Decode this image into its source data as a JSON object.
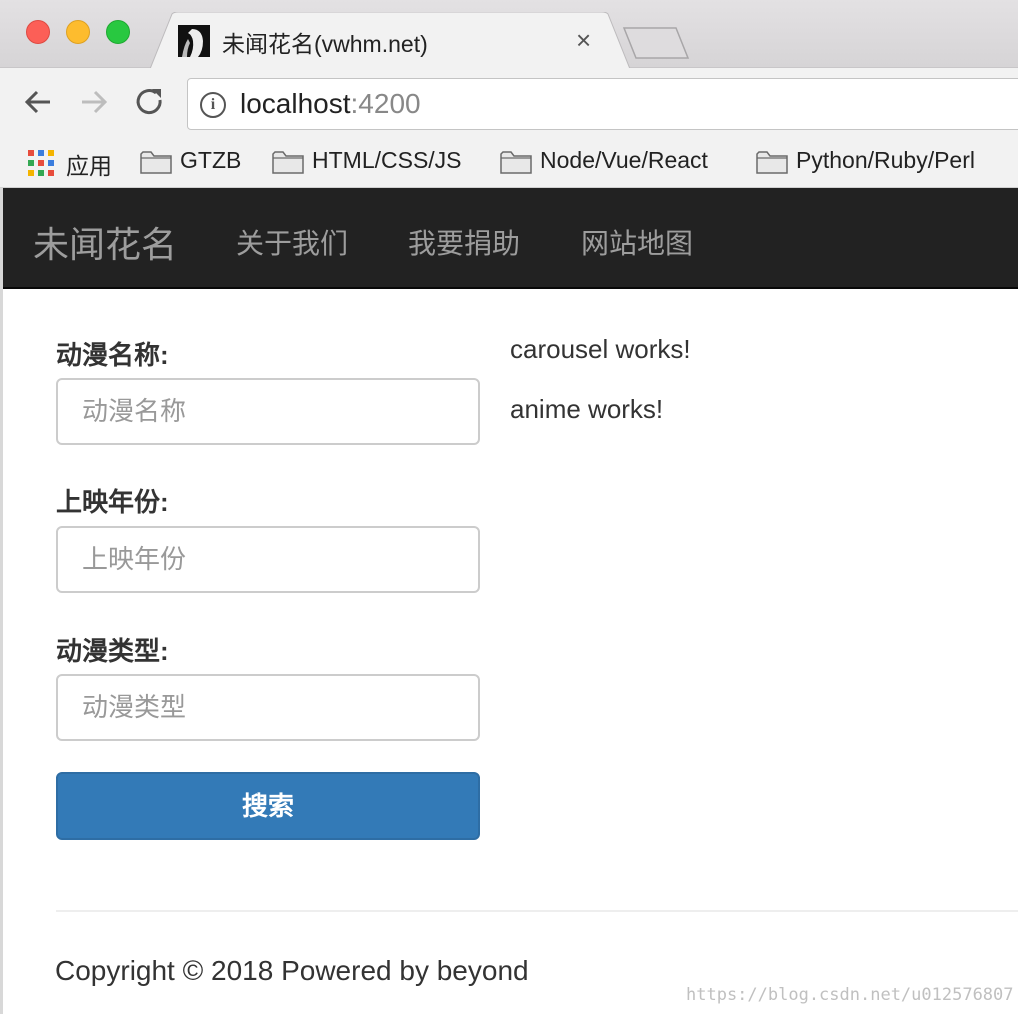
{
  "browser": {
    "tab": {
      "title": "未闻花名(vwhm.net)",
      "close_glyph": "×"
    },
    "address": {
      "host": "localhost",
      "port": ":4200"
    },
    "bookmarks": [
      {
        "label": "应用",
        "icon": "apps-grid-icon"
      },
      {
        "label": "GTZB",
        "icon": "folder-icon"
      },
      {
        "label": "HTML/CSS/JS",
        "icon": "folder-icon"
      },
      {
        "label": "Node/Vue/React",
        "icon": "folder-icon"
      },
      {
        "label": "Python/Ruby/Perl",
        "icon": "folder-icon"
      }
    ]
  },
  "navbar": {
    "brand": "未闻花名",
    "links": [
      "关于我们",
      "我要捐助",
      "网站地图"
    ]
  },
  "form": {
    "fields": [
      {
        "label": "动漫名称:",
        "placeholder": "动漫名称"
      },
      {
        "label": "上映年份:",
        "placeholder": "上映年份"
      },
      {
        "label": "动漫类型:",
        "placeholder": "动漫类型"
      }
    ],
    "submit_label": "搜索"
  },
  "side": {
    "carousel_text": "carousel works!",
    "anime_text": "anime works!"
  },
  "footer": {
    "copyright": "Copyright © 2018 Powered by beyond"
  },
  "watermark": "https://blog.csdn.net/u012576807",
  "colors": {
    "navbar_bg": "#222222",
    "nav_text": "#9d9d9d",
    "button_primary": "#337ab7"
  }
}
